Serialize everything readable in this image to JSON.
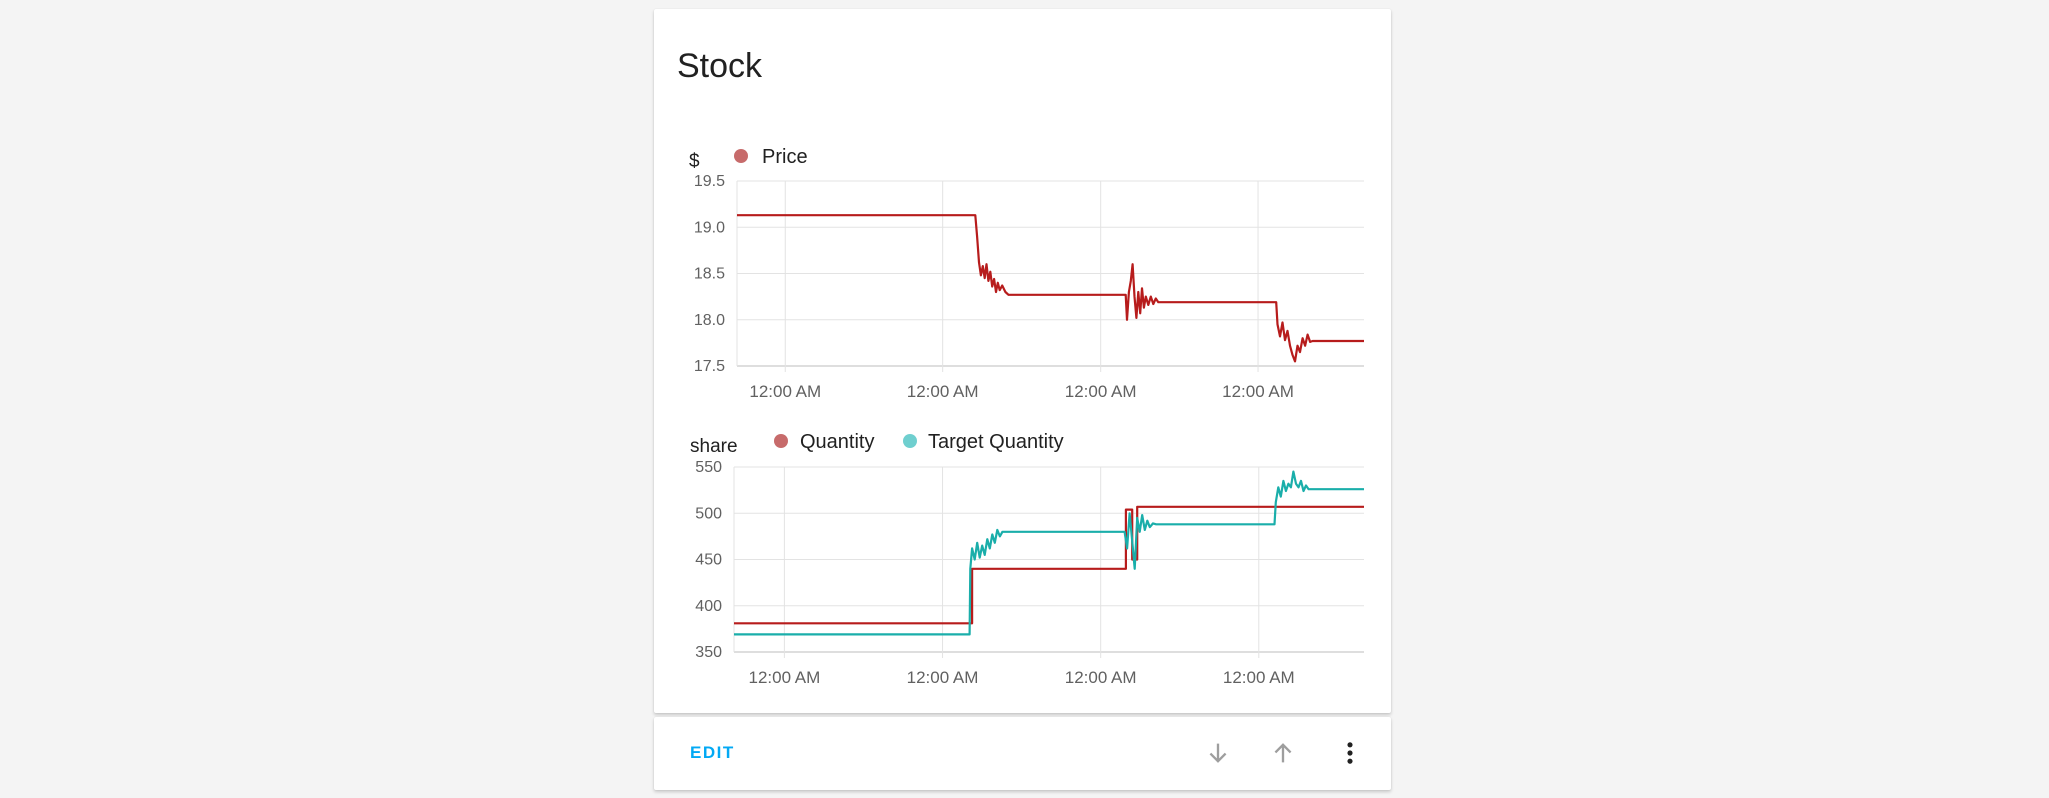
{
  "card": {
    "title": "Stock"
  },
  "actions": {
    "edit_label": "EDIT",
    "icons": [
      "arrow-down-icon",
      "arrow-up-icon",
      "more-vertical-icon"
    ]
  },
  "colors": {
    "price": "#b71c1c",
    "quantity": "#b71c1c",
    "target_quantity": "#1aaeaa",
    "legend_price": "#c76b6b",
    "legend_quantity": "#c76b6b",
    "legend_target": "#6fcfcf",
    "accent": "#03a9f4"
  },
  "chart_data": [
    {
      "type": "line",
      "unit_label": "$",
      "legend": [
        "Price"
      ],
      "ylim": [
        17.5,
        19.5
      ],
      "yticks": [
        19.5,
        19.0,
        18.5,
        18.0,
        17.5
      ],
      "xtick_labels": [
        "12:00 AM",
        "12:00 AM",
        "12:00 AM",
        "12:00 AM"
      ],
      "grid": true,
      "legend_placement": "top-left",
      "series": [
        {
          "name": "Price",
          "values": [
            [
              0.0,
              19.13
            ],
            [
              0.38,
              19.13
            ],
            [
              0.383,
              18.9
            ],
            [
              0.386,
              18.62
            ],
            [
              0.389,
              18.48
            ],
            [
              0.392,
              18.58
            ],
            [
              0.395,
              18.45
            ],
            [
              0.398,
              18.6
            ],
            [
              0.401,
              18.42
            ],
            [
              0.404,
              18.52
            ],
            [
              0.407,
              18.36
            ],
            [
              0.41,
              18.44
            ],
            [
              0.413,
              18.3
            ],
            [
              0.416,
              18.4
            ],
            [
              0.419,
              18.32
            ],
            [
              0.423,
              18.37
            ],
            [
              0.428,
              18.3
            ],
            [
              0.433,
              18.27
            ],
            [
              0.62,
              18.27
            ],
            [
              0.622,
              18.0
            ],
            [
              0.625,
              18.3
            ],
            [
              0.628,
              18.42
            ],
            [
              0.631,
              18.6
            ],
            [
              0.634,
              18.25
            ],
            [
              0.637,
              18.02
            ],
            [
              0.64,
              18.3
            ],
            [
              0.643,
              18.07
            ],
            [
              0.646,
              18.34
            ],
            [
              0.649,
              18.13
            ],
            [
              0.652,
              18.25
            ],
            [
              0.656,
              18.16
            ],
            [
              0.66,
              18.25
            ],
            [
              0.664,
              18.17
            ],
            [
              0.668,
              18.23
            ],
            [
              0.672,
              18.19
            ],
            [
              0.86,
              18.19
            ],
            [
              0.862,
              17.95
            ],
            [
              0.866,
              17.82
            ],
            [
              0.87,
              17.97
            ],
            [
              0.874,
              17.78
            ],
            [
              0.878,
              17.88
            ],
            [
              0.882,
              17.72
            ],
            [
              0.886,
              17.62
            ],
            [
              0.89,
              17.55
            ],
            [
              0.894,
              17.72
            ],
            [
              0.898,
              17.65
            ],
            [
              0.902,
              17.8
            ],
            [
              0.906,
              17.72
            ],
            [
              0.91,
              17.84
            ],
            [
              0.914,
              17.76
            ],
            [
              0.918,
              17.77
            ],
            [
              1.0,
              17.77
            ]
          ]
        }
      ]
    },
    {
      "type": "line",
      "unit_label": "share",
      "legend": [
        "Quantity",
        "Target Quantity"
      ],
      "ylim": [
        350,
        550
      ],
      "yticks": [
        550,
        500,
        450,
        400,
        350
      ],
      "xtick_labels": [
        "12:00 AM",
        "12:00 AM",
        "12:00 AM",
        "12:00 AM"
      ],
      "grid": true,
      "legend_placement": "top-left",
      "series": [
        {
          "name": "Quantity",
          "values": [
            [
              0.0,
              381
            ],
            [
              0.378,
              381
            ],
            [
              0.378,
              440
            ],
            [
              0.622,
              440
            ],
            [
              0.622,
              504
            ],
            [
              0.632,
              504
            ],
            [
              0.632,
              450
            ],
            [
              0.64,
              450
            ],
            [
              0.64,
              507
            ],
            [
              1.0,
              507
            ]
          ]
        },
        {
          "name": "Target Quantity",
          "values": [
            [
              0.0,
              369
            ],
            [
              0.374,
              369
            ],
            [
              0.375,
              440
            ],
            [
              0.378,
              462
            ],
            [
              0.382,
              450
            ],
            [
              0.386,
              468
            ],
            [
              0.39,
              452
            ],
            [
              0.394,
              465
            ],
            [
              0.398,
              455
            ],
            [
              0.402,
              472
            ],
            [
              0.406,
              462
            ],
            [
              0.41,
              477
            ],
            [
              0.414,
              468
            ],
            [
              0.418,
              482
            ],
            [
              0.422,
              475
            ],
            [
              0.426,
              480
            ],
            [
              0.62,
              480
            ],
            [
              0.624,
              462
            ],
            [
              0.628,
              500
            ],
            [
              0.632,
              470
            ],
            [
              0.636,
              440
            ],
            [
              0.64,
              495
            ],
            [
              0.644,
              480
            ],
            [
              0.648,
              498
            ],
            [
              0.652,
              482
            ],
            [
              0.656,
              492
            ],
            [
              0.66,
              485
            ],
            [
              0.665,
              489
            ],
            [
              0.67,
              488
            ],
            [
              0.858,
              488
            ],
            [
              0.86,
              512
            ],
            [
              0.864,
              528
            ],
            [
              0.868,
              518
            ],
            [
              0.872,
              535
            ],
            [
              0.876,
              524
            ],
            [
              0.88,
              532
            ],
            [
              0.884,
              528
            ],
            [
              0.888,
              545
            ],
            [
              0.892,
              532
            ],
            [
              0.896,
              528
            ],
            [
              0.9,
              535
            ],
            [
              0.904,
              524
            ],
            [
              0.908,
              530
            ],
            [
              0.912,
              526
            ],
            [
              1.0,
              526
            ]
          ]
        }
      ]
    }
  ]
}
